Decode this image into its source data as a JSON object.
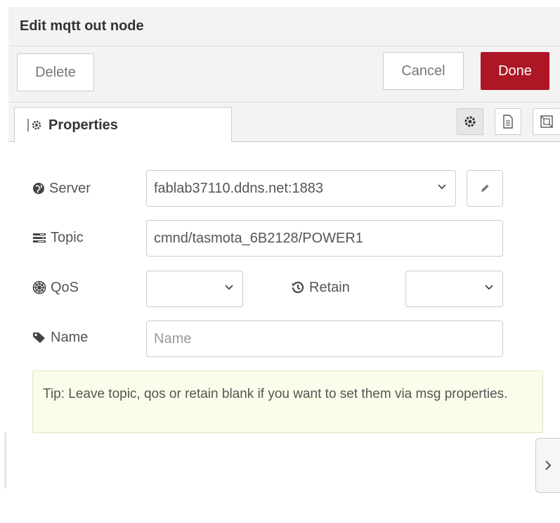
{
  "header": {
    "title": "Edit mqtt out node"
  },
  "toolbar": {
    "delete_label": "Delete",
    "cancel_label": "Cancel",
    "done_label": "Done"
  },
  "tabs": {
    "properties_label": "Properties",
    "icons": [
      "gear-icon",
      "document-icon",
      "layout-icon"
    ]
  },
  "form": {
    "server": {
      "label": "Server",
      "value": "fablab37110.ddns.net:1883"
    },
    "topic": {
      "label": "Topic",
      "value": "cmnd/tasmota_6B2128/POWER1"
    },
    "qos": {
      "label": "QoS",
      "value": ""
    },
    "retain": {
      "label": "Retain",
      "value": ""
    },
    "name": {
      "label": "Name",
      "placeholder": "Name",
      "value": ""
    }
  },
  "tip": {
    "text": "Tip: Leave topic, qos or retain blank if you want to set them via msg properties."
  },
  "colors": {
    "done": "#ad1625",
    "tip_bg": "#fcfcea",
    "header_bg": "#f3f3f3"
  }
}
